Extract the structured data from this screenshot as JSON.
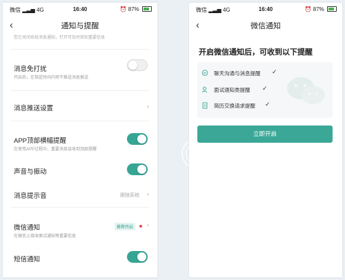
{
  "status_bar": {
    "left_text": "微信",
    "signal_text": "4G",
    "time": "16:40",
    "battery": "87%"
  },
  "left_screen": {
    "title": "通知与提醒",
    "top_hint": "您已关闭系统消息通知，打开可及时获知重要信息",
    "rows": [
      {
        "title": "消息免打扰",
        "subtitle": "开启后，在指定时间内将不推送消息推送",
        "toggle": "off"
      },
      {
        "title": "消息推送设置"
      },
      {
        "title": "APP顶部横幅提醒",
        "subtitle": "在使用APP过程中，重要消息会收到顶部提醒",
        "toggle": "on"
      },
      {
        "title": "声音与振动",
        "toggle": "on"
      },
      {
        "title": "消息提示音",
        "value": "跟随系统"
      },
      {
        "title": "微信通知",
        "subtitle": "在微信上接收面试通知等重要信息",
        "badge": "推荐开启"
      },
      {
        "title": "短信通知",
        "toggle": "on"
      }
    ]
  },
  "right_screen": {
    "title": "微信通知",
    "heading": "开启微信通知后，可收到以下提醒",
    "items": [
      {
        "label": "聊天沟通与消息提醒",
        "icon": "chat-bubble-icon"
      },
      {
        "label": "面试通知类提醒",
        "icon": "person-icon"
      },
      {
        "label": "简历交换请求提醒",
        "icon": "document-icon"
      }
    ],
    "button": "立即开启"
  },
  "colors": {
    "accent": "#3ba897",
    "toggle_on": "#37a594",
    "badge_text": "#2f9c8a",
    "badge_bg": "#e4f4f1",
    "red_dot": "#e64a4a",
    "background": "#eaf0f4"
  }
}
